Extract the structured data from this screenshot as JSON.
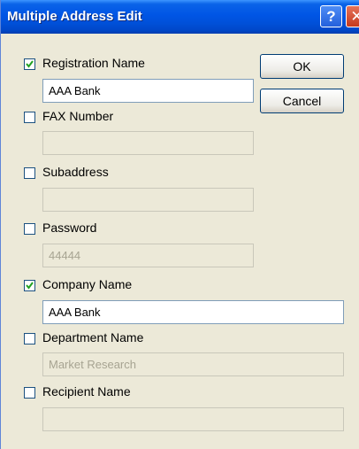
{
  "window": {
    "title": "Multiple Address Edit"
  },
  "titlebar_buttons": {
    "help": "?",
    "close": "✕"
  },
  "buttons": {
    "ok": "OK",
    "cancel": "Cancel"
  },
  "fields": [
    {
      "label": "Registration Name",
      "checked": true,
      "value": "AAA Bank",
      "enabled": true
    },
    {
      "label": "FAX Number",
      "checked": false,
      "value": "",
      "enabled": false
    },
    {
      "label": "Subaddress",
      "checked": false,
      "value": "",
      "enabled": false
    },
    {
      "label": "Password",
      "checked": false,
      "value": "44444",
      "enabled": false
    },
    {
      "label": "Company Name",
      "checked": true,
      "value": "AAA Bank",
      "enabled": true
    },
    {
      "label": "Department Name",
      "checked": false,
      "value": "Market Research",
      "enabled": false
    },
    {
      "label": "Recipient Name",
      "checked": false,
      "value": "",
      "enabled": false
    }
  ]
}
